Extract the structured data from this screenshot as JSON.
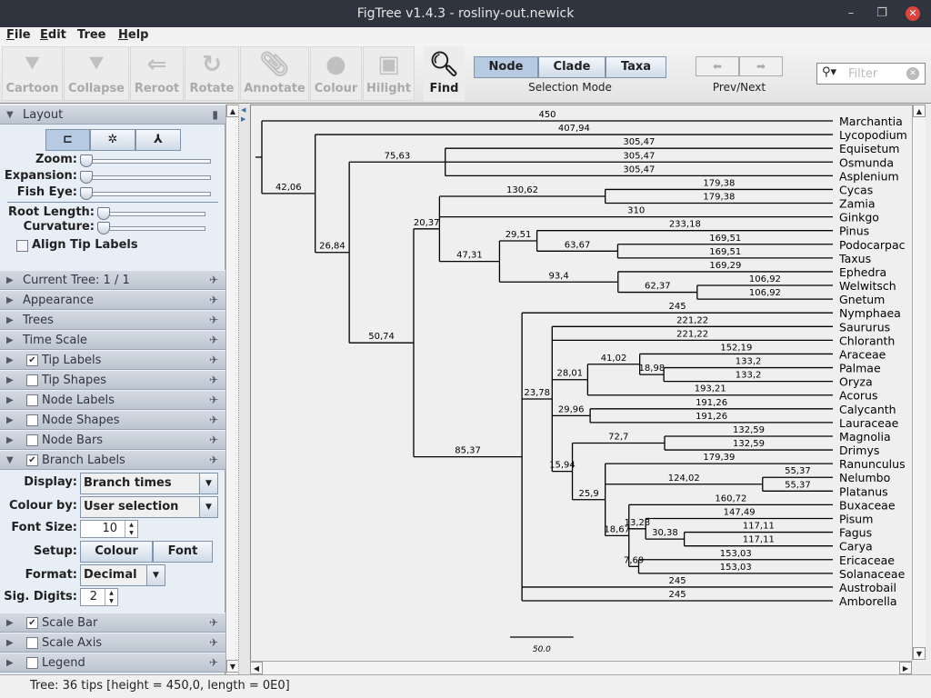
{
  "window": {
    "title": "FigTree v1.4.3 - rosliny-out.newick"
  },
  "menu": [
    {
      "key": "F",
      "rest": "ile"
    },
    {
      "key": "E",
      "rest": "dit"
    },
    {
      "key": "",
      "rest": "Tree"
    },
    {
      "key": "H",
      "rest": "elp"
    }
  ],
  "toolbar": {
    "buttons": [
      {
        "label": "Cartoon",
        "icon": "cartoon-icon"
      },
      {
        "label": "Collapse",
        "icon": "collapse-icon"
      },
      {
        "label": "Reroot",
        "icon": "reroot-icon"
      },
      {
        "label": "Rotate",
        "icon": "rotate-icon"
      },
      {
        "label": "Annotate",
        "icon": "paperclip-icon"
      },
      {
        "label": "Colour",
        "icon": "colour-circle-icon"
      },
      {
        "label": "Hilight",
        "icon": "hilight-icon"
      }
    ],
    "find": "Find",
    "selection_modes": [
      "Node",
      "Clade",
      "Taxa"
    ],
    "selection_selected": "Node",
    "selection_label": "Selection Mode",
    "prevnext_label": "Prev/Next",
    "filter_placeholder": "Filter"
  },
  "layout_panel": {
    "title": "Layout",
    "zoom": "Zoom:",
    "expansion": "Expansion:",
    "fisheye": "Fish Eye:",
    "root_length": "Root Length:",
    "curvature": "Curvature:",
    "align_tip_labels": "Align Tip Labels",
    "align_checked": false
  },
  "sections": [
    {
      "label": "Current Tree: 1 / 1",
      "checkbox": null
    },
    {
      "label": "Appearance",
      "checkbox": null
    },
    {
      "label": "Trees",
      "checkbox": null
    },
    {
      "label": "Time Scale",
      "checkbox": null
    },
    {
      "label": "Tip Labels",
      "checkbox": true
    },
    {
      "label": "Tip Shapes",
      "checkbox": false
    },
    {
      "label": "Node Labels",
      "checkbox": false
    },
    {
      "label": "Node Shapes",
      "checkbox": false
    },
    {
      "label": "Node Bars",
      "checkbox": false
    },
    {
      "label": "Branch Labels",
      "checkbox": true
    }
  ],
  "branch_labels": {
    "display_label": "Display:",
    "display_value": "Branch times",
    "colour_label": "Colour by:",
    "colour_value": "User selection",
    "font_size_label": "Font Size:",
    "font_size": "10",
    "setup_label": "Setup:",
    "colour_btn": "Colour",
    "font_btn": "Font",
    "format_label": "Format:",
    "format_value": "Decimal",
    "sig_label": "Sig. Digits:",
    "sig_digits": "2"
  },
  "bottom_sections": [
    {
      "label": "Scale Bar",
      "checkbox": true
    },
    {
      "label": "Scale Axis",
      "checkbox": false
    },
    {
      "label": "Legend",
      "checkbox": false
    }
  ],
  "scale_bar": {
    "value": "50.0",
    "length": 50
  },
  "status": "Tree: 36 tips [height = 450,0, length = 0E0]",
  "tree": {
    "children": [
      {
        "name": "Marchantia",
        "length": "450"
      },
      {
        "length": "42,06",
        "children": [
          {
            "name": "Lycopodium",
            "length": "407,94"
          },
          {
            "length": "26,84",
            "children": [
              {
                "length": "75,63",
                "children": [
                  {
                    "name": "Equisetum",
                    "length": "305,47"
                  },
                  {
                    "name": "Osmunda",
                    "length": "305,47"
                  },
                  {
                    "name": "Asplenium",
                    "length": "305,47"
                  }
                ]
              },
              {
                "length": "50,74",
                "children": [
                  {
                    "length": "20,37",
                    "children": [
                      {
                        "length": "130,62",
                        "children": [
                          {
                            "name": "Cycas",
                            "length": "179,38"
                          },
                          {
                            "name": "Zamia",
                            "length": "179,38"
                          }
                        ]
                      },
                      {
                        "name": "Ginkgo",
                        "length": "310"
                      },
                      {
                        "length": "47,31",
                        "children": [
                          {
                            "length": "29,51",
                            "children": [
                              {
                                "name": "Pinus",
                                "length": "233,18"
                              },
                              {
                                "length": "63,67",
                                "children": [
                                  {
                                    "name": "Podocarpac",
                                    "length": "169,51"
                                  },
                                  {
                                    "name": "Taxus",
                                    "length": "169,51"
                                  }
                                ]
                              }
                            ]
                          },
                          {
                            "length": "93,4",
                            "children": [
                              {
                                "name": "Ephedra",
                                "length": "169,29"
                              },
                              {
                                "length": "62,37",
                                "children": [
                                  {
                                    "name": "Welwitsch",
                                    "length": "106,92"
                                  },
                                  {
                                    "name": "Gnetum",
                                    "length": "106,92"
                                  }
                                ]
                              }
                            ]
                          }
                        ]
                      }
                    ]
                  },
                  {
                    "length": "85,37",
                    "children": [
                      {
                        "name": "Nymphaea",
                        "length": "245"
                      },
                      {
                        "length": "23,78",
                        "children": [
                          {
                            "name": "Saururus",
                            "length": "221,22"
                          },
                          {
                            "name": "Chloranth",
                            "length": "221,22"
                          },
                          {
                            "length": "28,01",
                            "children": [
                              {
                                "length": "41,02",
                                "children": [
                                  {
                                    "name": "Araceae",
                                    "length": "152,19"
                                  },
                                  {
                                    "length": "18,98",
                                    "children": [
                                      {
                                        "name": "Palmae",
                                        "length": "133,2"
                                      },
                                      {
                                        "name": "Oryza",
                                        "length": "133,2"
                                      }
                                    ]
                                  }
                                ]
                              },
                              {
                                "name": "Acorus",
                                "length": "193,21"
                              }
                            ]
                          },
                          {
                            "length": "29,96",
                            "children": [
                              {
                                "name": "Calycanth",
                                "length": "191,26"
                              },
                              {
                                "name": "Lauraceae",
                                "length": "191,26"
                              }
                            ]
                          },
                          {
                            "length": "15,94",
                            "children": [
                              {
                                "length": "72,7",
                                "children": [
                                  {
                                    "name": "Magnolia",
                                    "length": "132,59"
                                  },
                                  {
                                    "name": "Drimys",
                                    "length": "132,59"
                                  }
                                ]
                              },
                              {
                                "length": "25,9",
                                "children": [
                                  {
                                    "name": "Ranunculus",
                                    "length": "179,39"
                                  },
                                  {
                                    "length": "124,02",
                                    "children": [
                                      {
                                        "name": "Nelumbo",
                                        "length": "55,37"
                                      },
                                      {
                                        "name": "Platanus",
                                        "length": "55,37"
                                      }
                                    ]
                                  },
                                  {
                                    "length": "18,67",
                                    "children": [
                                      {
                                        "name": "Buxaceae",
                                        "length": "160,72"
                                      },
                                      {
                                        "length": "13,23",
                                        "children": [
                                          {
                                            "name": "Pisum",
                                            "length": "147,49"
                                          },
                                          {
                                            "length": "30,38",
                                            "children": [
                                              {
                                                "name": "Fagus",
                                                "length": "117,11"
                                              },
                                              {
                                                "name": "Carya",
                                                "length": "117,11"
                                              }
                                            ]
                                          }
                                        ]
                                      },
                                      {
                                        "length": "7,69",
                                        "children": [
                                          {
                                            "name": "Ericaceae",
                                            "length": "153,03"
                                          },
                                          {
                                            "name": "Solanaceae",
                                            "length": "153,03"
                                          }
                                        ]
                                      }
                                    ]
                                  }
                                ]
                              }
                            ]
                          }
                        ]
                      },
                      {
                        "name": "Austrobail",
                        "length": "245"
                      },
                      {
                        "name": "Amborella",
                        "length": "245"
                      }
                    ]
                  }
                ]
              }
            ]
          }
        ]
      }
    ]
  }
}
